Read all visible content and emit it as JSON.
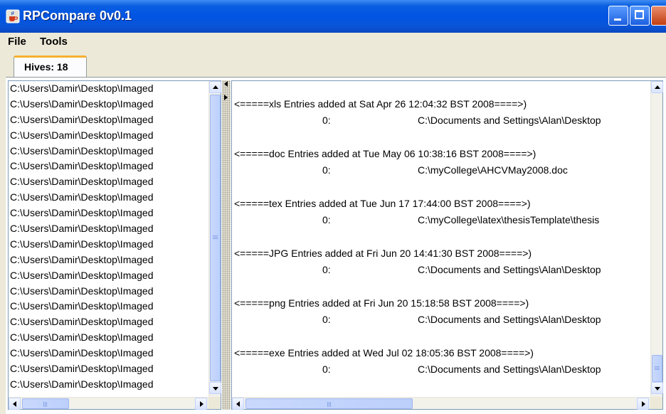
{
  "window": {
    "title": "RPCompare 0v0.1"
  },
  "menu": [
    "File",
    "Tools"
  ],
  "tab": {
    "label": "Hives: 18"
  },
  "left_list": [
    "C:\\Users\\Damir\\Desktop\\Imaged",
    "C:\\Users\\Damir\\Desktop\\Imaged",
    "C:\\Users\\Damir\\Desktop\\Imaged",
    "C:\\Users\\Damir\\Desktop\\Imaged",
    "C:\\Users\\Damir\\Desktop\\Imaged",
    "C:\\Users\\Damir\\Desktop\\Imaged",
    "C:\\Users\\Damir\\Desktop\\Imaged",
    "C:\\Users\\Damir\\Desktop\\Imaged",
    "C:\\Users\\Damir\\Desktop\\Imaged",
    "C:\\Users\\Damir\\Desktop\\Imaged",
    "C:\\Users\\Damir\\Desktop\\Imaged",
    "C:\\Users\\Damir\\Desktop\\Imaged",
    "C:\\Users\\Damir\\Desktop\\Imaged",
    "C:\\Users\\Damir\\Desktop\\Imaged",
    "C:\\Users\\Damir\\Desktop\\Imaged",
    "C:\\Users\\Damir\\Desktop\\Imaged",
    "C:\\Users\\Damir\\Desktop\\Imaged",
    "C:\\Users\\Damir\\Desktop\\Imaged",
    "C:\\Users\\Damir\\Desktop\\Imaged",
    "C:\\Users\\Damir\\Desktop\\Imaged"
  ],
  "entries": [
    {
      "header": "<=====xls Entries added at Sat Apr 26 12:04:32 BST 2008====>)",
      "index": "0:",
      "path": "C:\\Documents and Settings\\Alan\\Desktop"
    },
    {
      "header": "<=====doc Entries added at Tue May 06 10:38:16 BST 2008====>)",
      "index": "0:",
      "path": "C:\\myCollege\\AHCVMay2008.doc"
    },
    {
      "header": "<=====tex Entries added at Tue Jun 17 17:44:00 BST 2008====>)",
      "index": "0:",
      "path": "C:\\myCollege\\latex\\thesisTemplate\\thesis"
    },
    {
      "header": "<=====JPG Entries added at Fri Jun 20 14:41:30 BST 2008====>)",
      "index": "0:",
      "path": "C:\\Documents and Settings\\Alan\\Desktop"
    },
    {
      "header": "<=====png Entries added at Fri Jun 20 15:18:58 BST 2008====>)",
      "index": "0:",
      "path": "C:\\Documents and Settings\\Alan\\Desktop"
    },
    {
      "header": "<=====exe Entries added at Wed Jul 02 18:05:36 BST 2008====>)",
      "index": "0:",
      "path": "C:\\Documents and Settings\\Alan\\Desktop"
    }
  ]
}
